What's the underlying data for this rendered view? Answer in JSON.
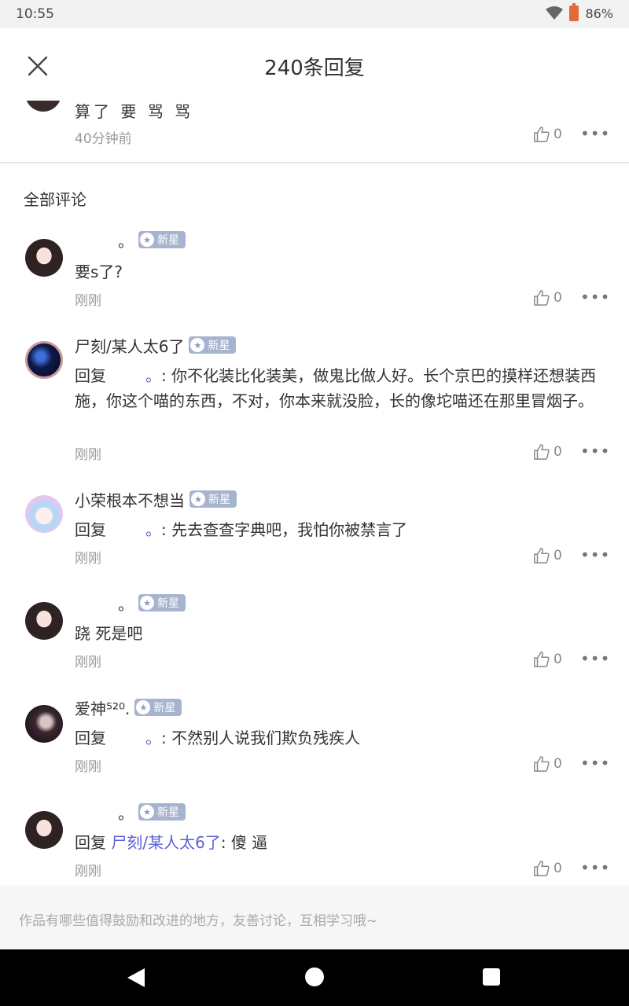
{
  "status_bar": {
    "time": "10:55",
    "battery": "86%"
  },
  "header": {
    "title": "240条回复"
  },
  "original_comment": {
    "text": "算了 要 骂 骂",
    "time": "40分钟前",
    "likes": "0"
  },
  "section_title": "全部评论",
  "reply_prefix": "回复",
  "badge_label": "新星",
  "comments": [
    {
      "name": "。",
      "text": "要s了?",
      "time": "刚刚",
      "likes": "0"
    },
    {
      "name": "尸刻/某人太6了",
      "reply_to": "。",
      "text": ": 你不化装比化装美，做鬼比做人好。长个京巴的摸样还想装西施，你这个喵的东西，不对，你本来就没脸，长的像坨喵还在那里冒烟子。",
      "time": "刚刚",
      "likes": "0"
    },
    {
      "name": "小荣根本不想当",
      "reply_to": "。",
      "text": ": 先去查查字典吧，我怕你被禁言了",
      "time": "刚刚",
      "likes": "0"
    },
    {
      "name": "。",
      "text": "跷  死是吧",
      "time": "刚刚",
      "likes": "0"
    },
    {
      "name": "爱神⁵²⁰.",
      "reply_to": "。",
      "text": ": 不然别人说我们欺负残疾人",
      "time": "刚刚",
      "likes": "0"
    },
    {
      "name": "。",
      "reply_to": "尸刻/某人太6了",
      "text": ": 傻  逼",
      "time": "刚刚",
      "likes": "0"
    }
  ],
  "input": {
    "placeholder": "作品有哪些值得鼓励和改进的地方，友善讨论，互相学习哦~"
  },
  "colors": {
    "badge": "#a7b4cf",
    "reply_link": "#5b5fd6",
    "nav_bar": "#000000"
  }
}
